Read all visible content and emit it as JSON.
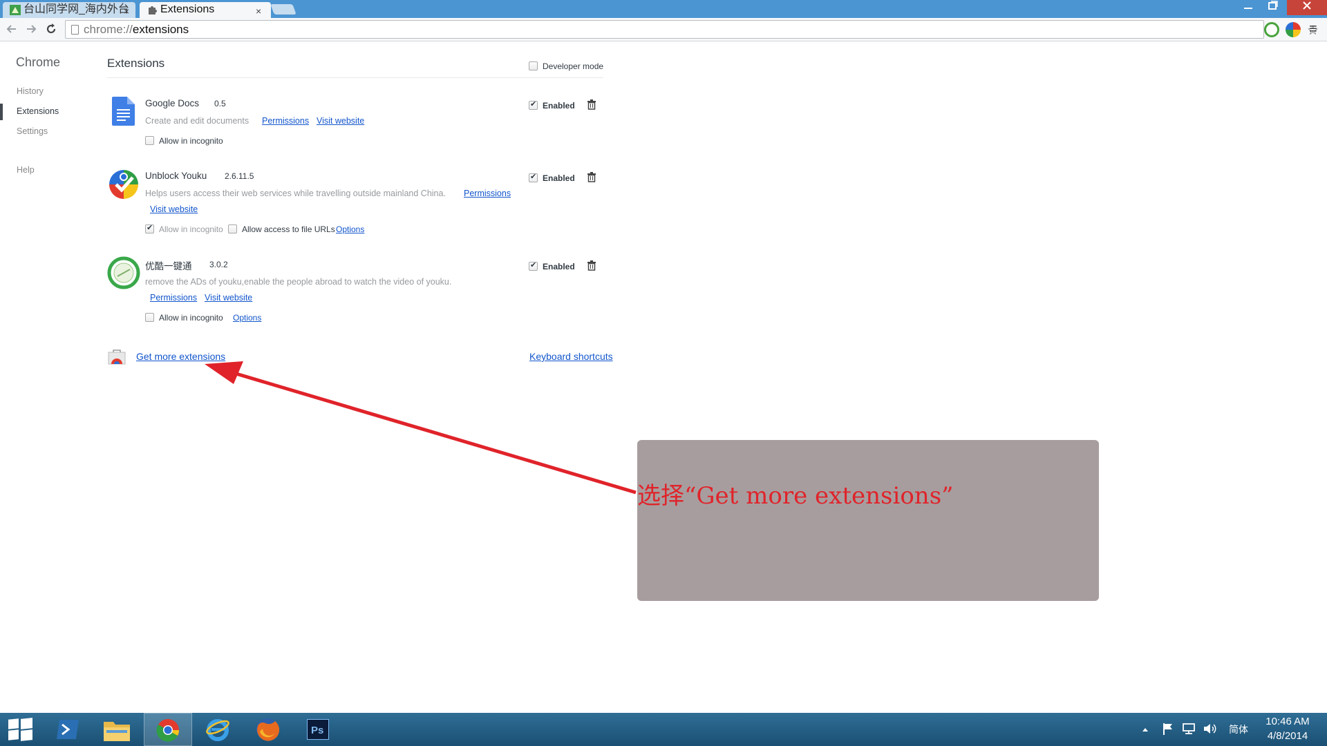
{
  "browser": {
    "tabs": [
      {
        "title": "台山同学网_海内外台",
        "active": false
      },
      {
        "title": "Extensions",
        "active": true
      }
    ],
    "tab_close": "×",
    "url_scheme": "chrome://",
    "url_host": "extensions"
  },
  "sidebar": {
    "title": "Chrome",
    "items": [
      {
        "label": "History",
        "selected": false
      },
      {
        "label": "Extensions",
        "selected": true
      },
      {
        "label": "Settings",
        "selected": false
      },
      {
        "label": "Help",
        "selected": false
      }
    ]
  },
  "main": {
    "heading": "Extensions",
    "developer_mode": {
      "label": "Developer mode",
      "checked": false
    },
    "extensions": [
      {
        "name": "Google Docs",
        "version": "0.5",
        "description": "Create and edit documents",
        "links": {
          "permissions": "Permissions",
          "visit_website": "Visit website"
        },
        "allow_incognito": {
          "label": "Allow in incognito",
          "checked": false
        },
        "enabled": {
          "label": "Enabled",
          "checked": true
        }
      },
      {
        "name": "Unblock Youku",
        "version": "2.6.11.5",
        "description": "Helps users access their web services while travelling outside mainland China.",
        "links": {
          "permissions": "Permissions",
          "visit_website": "Visit website",
          "options": "Options"
        },
        "allow_incognito": {
          "label": "Allow in incognito",
          "checked": true
        },
        "allow_file_urls": {
          "label": "Allow access to file URLs",
          "checked": false
        },
        "enabled": {
          "label": "Enabled",
          "checked": true
        }
      },
      {
        "name": "优酷一键通",
        "version": "3.0.2",
        "description": "remove the ADs of youku,enable the people abroad to watch the video of youku.",
        "links": {
          "permissions": "Permissions",
          "visit_website": "Visit website",
          "options": "Options"
        },
        "allow_incognito": {
          "label": "Allow in incognito",
          "checked": false
        },
        "enabled": {
          "label": "Enabled",
          "checked": true
        }
      }
    ],
    "get_more": "Get more extensions",
    "keyboard_shortcuts": "Keyboard shortcuts"
  },
  "annotation": {
    "text": "选择“Get more extensions”",
    "color": "#e0232a"
  },
  "taskbar": {
    "ime": "简体",
    "time": "10:46 AM",
    "date": "4/8/2014"
  },
  "colors": {
    "titlebar": "#4b95d3",
    "link": "#1155cc",
    "close_button": "#c7443a",
    "callout_bg": "#a89d9e"
  }
}
